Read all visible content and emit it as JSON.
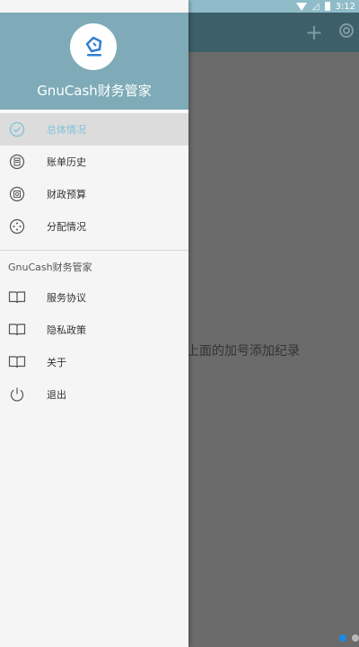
{
  "status_bar": {
    "time": "3:12"
  },
  "appbar": {
    "add_icon": "plus-icon",
    "settings_icon": "gear-icon"
  },
  "main": {
    "empty_message": "点击上面的加号添加纪录"
  },
  "drawer": {
    "app_title": "GnuCash财务管家",
    "section_title": "GnuCash财务管家",
    "nav_items": [
      {
        "label": "总体情况",
        "icon": "check-circle-icon",
        "selected": true
      },
      {
        "label": "账单历史",
        "icon": "history-icon"
      },
      {
        "label": "财政预算",
        "icon": "budget-icon"
      },
      {
        "label": "分配情况",
        "icon": "allocation-icon"
      }
    ],
    "info_items": [
      {
        "label": "服务协议",
        "icon": "book-icon"
      },
      {
        "label": "隐私政策",
        "icon": "book-icon"
      },
      {
        "label": "关于",
        "icon": "book-icon"
      },
      {
        "label": "退出",
        "icon": "power-icon"
      }
    ]
  },
  "colors": {
    "header": "#7fabb8",
    "selected_text": "#7fc2d8",
    "appbar": "#3c5f69",
    "dot_active": "#1e88e5"
  }
}
